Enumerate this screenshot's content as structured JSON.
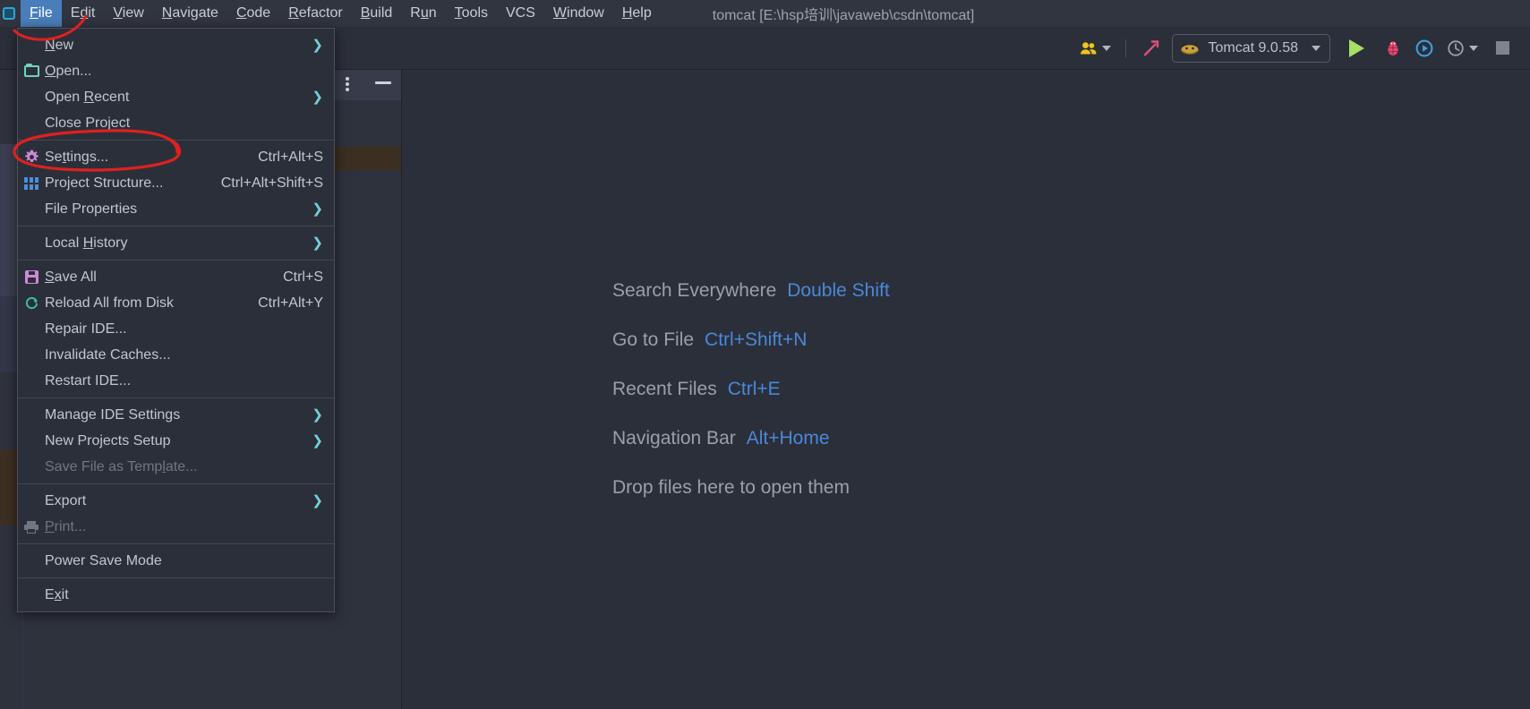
{
  "window": {
    "title": "tomcat [E:\\hsp培训\\javaweb\\csdn\\tomcat]"
  },
  "menubar": {
    "items": [
      {
        "label": "File",
        "mnemonic": "F",
        "active": true
      },
      {
        "label": "Edit",
        "mnemonic": "E",
        "active": false
      },
      {
        "label": "View",
        "mnemonic": "V",
        "active": false
      },
      {
        "label": "Navigate",
        "mnemonic": "N",
        "active": false
      },
      {
        "label": "Code",
        "mnemonic": "C",
        "active": false
      },
      {
        "label": "Refactor",
        "mnemonic": "R",
        "active": false
      },
      {
        "label": "Build",
        "mnemonic": "B",
        "active": false
      },
      {
        "label": "Run",
        "mnemonic": "u",
        "active": false
      },
      {
        "label": "Tools",
        "mnemonic": "T",
        "active": false
      },
      {
        "label": "VCS",
        "mnemonic": "",
        "active": false
      },
      {
        "label": "Window",
        "mnemonic": "W",
        "active": false
      },
      {
        "label": "Help",
        "mnemonic": "H",
        "active": false
      }
    ]
  },
  "toolbar": {
    "run_configuration": "Tomcat 9.0.58",
    "icons": {
      "account": "account-icon",
      "build": "hammer-build-icon",
      "tomcat": "tomcat-cat-icon",
      "run": "run-play-icon",
      "debug": "debug-bug-icon",
      "run_coverage": "run-with-coverage-icon",
      "profiler": "profiler-icon",
      "stop": "stop-icon"
    }
  },
  "file_menu": {
    "groups": [
      {
        "items": [
          {
            "label": "New",
            "mnemonic": "N",
            "icon": "",
            "shortcut": "",
            "submenu": true,
            "disabled": false
          },
          {
            "label": "Open...",
            "mnemonic": "O",
            "icon": "folder-icon",
            "shortcut": "",
            "submenu": false,
            "disabled": false
          },
          {
            "label": "Open Recent",
            "mnemonic": "R",
            "icon": "",
            "shortcut": "",
            "submenu": true,
            "disabled": false
          },
          {
            "label": "Close Project",
            "mnemonic": "",
            "icon": "",
            "shortcut": "",
            "submenu": false,
            "disabled": false
          }
        ]
      },
      {
        "items": [
          {
            "label": "Settings...",
            "mnemonic": "t",
            "icon": "gear-icon",
            "shortcut": "Ctrl+Alt+S",
            "submenu": false,
            "disabled": false
          },
          {
            "label": "Project Structure...",
            "mnemonic": "",
            "icon": "grid-icon",
            "shortcut": "Ctrl+Alt+Shift+S",
            "submenu": false,
            "disabled": false
          },
          {
            "label": "File Properties",
            "mnemonic": "",
            "icon": "",
            "shortcut": "",
            "submenu": true,
            "disabled": false
          }
        ]
      },
      {
        "items": [
          {
            "label": "Local History",
            "mnemonic": "H",
            "icon": "",
            "shortcut": "",
            "submenu": true,
            "disabled": false
          }
        ]
      },
      {
        "items": [
          {
            "label": "Save All",
            "mnemonic": "S",
            "icon": "save-icon",
            "shortcut": "Ctrl+S",
            "submenu": false,
            "disabled": false
          },
          {
            "label": "Reload All from Disk",
            "mnemonic": "",
            "icon": "reload-icon",
            "shortcut": "Ctrl+Alt+Y",
            "submenu": false,
            "disabled": false
          },
          {
            "label": "Repair IDE...",
            "mnemonic": "",
            "icon": "",
            "shortcut": "",
            "submenu": false,
            "disabled": false
          },
          {
            "label": "Invalidate Caches...",
            "mnemonic": "",
            "icon": "",
            "shortcut": "",
            "submenu": false,
            "disabled": false
          },
          {
            "label": "Restart IDE...",
            "mnemonic": "",
            "icon": "",
            "shortcut": "",
            "submenu": false,
            "disabled": false
          }
        ]
      },
      {
        "items": [
          {
            "label": "Manage IDE Settings",
            "mnemonic": "",
            "icon": "",
            "shortcut": "",
            "submenu": true,
            "disabled": false
          },
          {
            "label": "New Projects Setup",
            "mnemonic": "",
            "icon": "",
            "shortcut": "",
            "submenu": true,
            "disabled": false
          },
          {
            "label": "Save File as Template...",
            "mnemonic": "l",
            "icon": "",
            "shortcut": "",
            "submenu": false,
            "disabled": true
          }
        ]
      },
      {
        "items": [
          {
            "label": "Export",
            "mnemonic": "",
            "icon": "",
            "shortcut": "",
            "submenu": true,
            "disabled": false
          },
          {
            "label": "Print...",
            "mnemonic": "P",
            "icon": "printer-icon",
            "shortcut": "",
            "submenu": false,
            "disabled": true
          }
        ]
      },
      {
        "items": [
          {
            "label": "Power Save Mode",
            "mnemonic": "",
            "icon": "",
            "shortcut": "",
            "submenu": false,
            "disabled": false
          }
        ]
      },
      {
        "items": [
          {
            "label": "Exit",
            "mnemonic": "x",
            "icon": "",
            "shortcut": "",
            "submenu": false,
            "disabled": false
          }
        ]
      }
    ]
  },
  "editor_tips": [
    {
      "label": "Search Everywhere",
      "key": "Double Shift"
    },
    {
      "label": "Go to File",
      "key": "Ctrl+Shift+N"
    },
    {
      "label": "Recent Files",
      "key": "Ctrl+E"
    },
    {
      "label": "Navigation Bar",
      "key": "Alt+Home"
    },
    {
      "label": "Drop files here to open them",
      "key": ""
    }
  ],
  "colors": {
    "background": "#2b2f3a",
    "menu_active": "#4a7ebb",
    "tip_key": "#4a88d8",
    "annotation": "#e02020",
    "text": "#c2c6cd"
  },
  "annotation": {
    "shape": "red-hand-drawn-ellipse",
    "target": "Settings..."
  }
}
